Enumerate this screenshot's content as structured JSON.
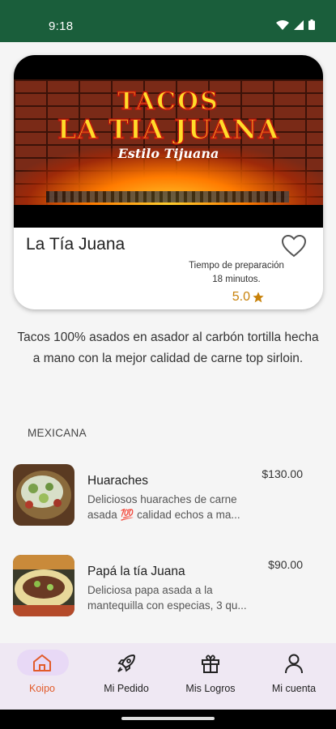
{
  "status_bar": {
    "time": "9:18"
  },
  "restaurant": {
    "banner_title_line1": "TACOS",
    "banner_title_line2": "LA TIA JUANA",
    "banner_subtitle": "Estilo Tijuana",
    "name": "La Tía Juana",
    "prep_label": "Tiempo de preparación",
    "prep_time": "18 minutos.",
    "rating": "5.0",
    "description": "Tacos 100% asados en asador al carbón tortilla hecha a mano con la mejor calidad de carne top sirloin."
  },
  "category": "MEXICANA",
  "menu_items": [
    {
      "name": "Huaraches",
      "description": "Deliciosos huaraches de carne asada 💯 calidad echos a ma...",
      "price": "$130.00"
    },
    {
      "name": "Papá la tía Juana",
      "description": "Deliciosa papa asada a la mantequilla con especias, 3 qu...",
      "price": "$90.00"
    }
  ],
  "nav": [
    {
      "label": "Koipo",
      "icon": "home-icon",
      "active": true
    },
    {
      "label": "Mi Pedido",
      "icon": "rocket-icon",
      "active": false
    },
    {
      "label": "Mis Logros",
      "icon": "gift-icon",
      "active": false
    },
    {
      "label": "Mi cuenta",
      "icon": "user-icon",
      "active": false
    }
  ],
  "colors": {
    "status_bar": "#1a5e3b",
    "accent": "#e25b2a",
    "rating": "#c8820a",
    "nav_bg": "#efe8f3"
  }
}
